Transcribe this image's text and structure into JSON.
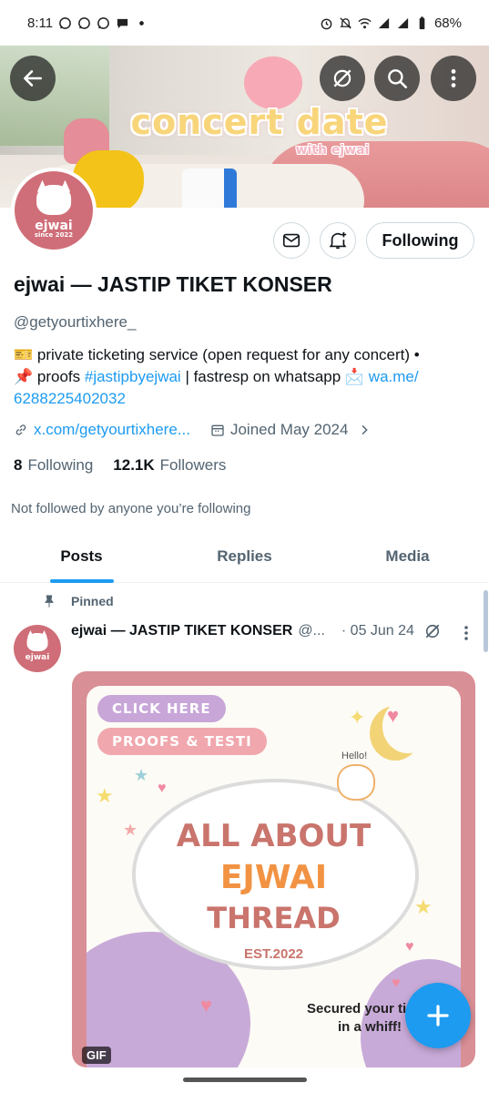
{
  "status_bar": {
    "time": "8:11",
    "battery": "68%",
    "left_icons": [
      "whatsapp-icon",
      "whatsapp-icon",
      "whatsapp-icon",
      "chat-bubble-icon",
      "dot-icon"
    ],
    "right_icons": [
      "alarm-icon",
      "mute-icon",
      "wifi-icon",
      "signal-icon",
      "signal-icon",
      "battery-icon"
    ]
  },
  "banner": {
    "title": "concert date",
    "subtitle": "with ejwai"
  },
  "avatar_label": "ejwai",
  "avatar_sublabel": "since 2022",
  "profile": {
    "name": "ejwai — JASTIP TIKET KONSER",
    "handle": "@getyourtixhere_",
    "bio": {
      "line1": "🎫 private ticketing service (open request for any concert) •",
      "line2_prefix": "📌 proofs ",
      "hashtag": "#jastipbyejwai",
      "line2_mid": " | fastresp on whatsapp 📩 ",
      "wa_link_part1": "wa.me/",
      "wa_link_part2": "6288225402032"
    },
    "website": "x.com/getyourtixhere...",
    "joined": "Joined May 2024",
    "following_count": "8",
    "following_label": "Following",
    "followers_count": "12.1K",
    "followers_label": "Followers",
    "mutual_note": "Not followed by anyone you’re following"
  },
  "actions": {
    "following_button": "Following"
  },
  "tabs": [
    {
      "label": "Posts",
      "active": true
    },
    {
      "label": "Replies",
      "active": false
    },
    {
      "label": "Media",
      "active": false
    }
  ],
  "pinned_post": {
    "pinned_label": "Pinned",
    "author": "ejwai — JASTIP TIKET KONSER",
    "handle": "@...",
    "date": "· 05 Jun 24",
    "media": {
      "pill1": "CLICK HERE",
      "pill2": "PROOFS & TESTI",
      "line1": "ALL ABOUT",
      "line2": "EJWAI",
      "line3": "THREAD",
      "est": "EST.2022",
      "hello": "Hello!",
      "secured_line1": "Secured your ti",
      "secured_line2": "in a whiff!",
      "badge": "GIF"
    }
  },
  "colors": {
    "accent": "#1d9bf0",
    "text_primary": "#0f1419",
    "text_secondary": "#536471",
    "avatar_bg": "#cf6e78"
  }
}
